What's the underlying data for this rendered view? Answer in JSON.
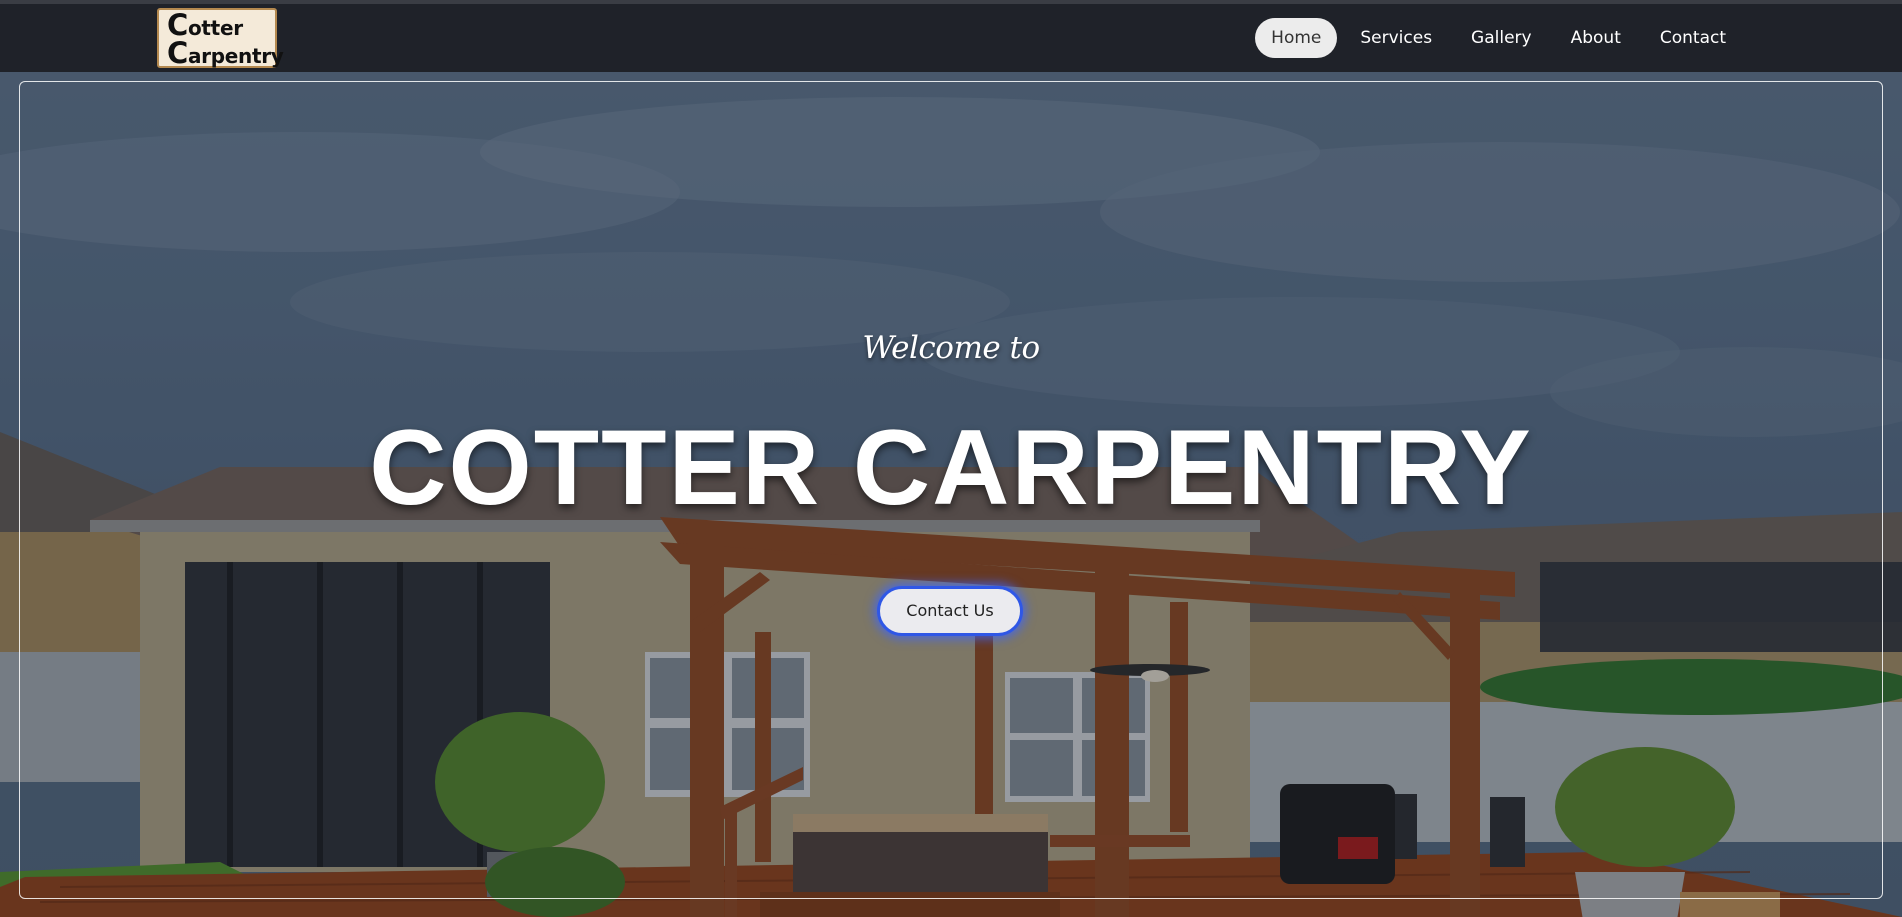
{
  "logo": {
    "line1_cap": "C",
    "line1_rest": "otter",
    "line2_cap": "C",
    "line2_rest": "arpentry"
  },
  "nav": {
    "items": [
      {
        "label": "Home",
        "active": true
      },
      {
        "label": "Services",
        "active": false
      },
      {
        "label": "Gallery",
        "active": false
      },
      {
        "label": "About",
        "active": false
      },
      {
        "label": "Contact",
        "active": false
      }
    ]
  },
  "hero": {
    "welcome": "Welcome to",
    "title": "COTTER CARPENTRY",
    "cta_label": "Contact Us"
  },
  "colors": {
    "navbar_bg": "#1f2229",
    "cta_border": "#2f57e6",
    "logo_bg": "#f4ead9",
    "deck_wood": "#8a3f1a"
  }
}
